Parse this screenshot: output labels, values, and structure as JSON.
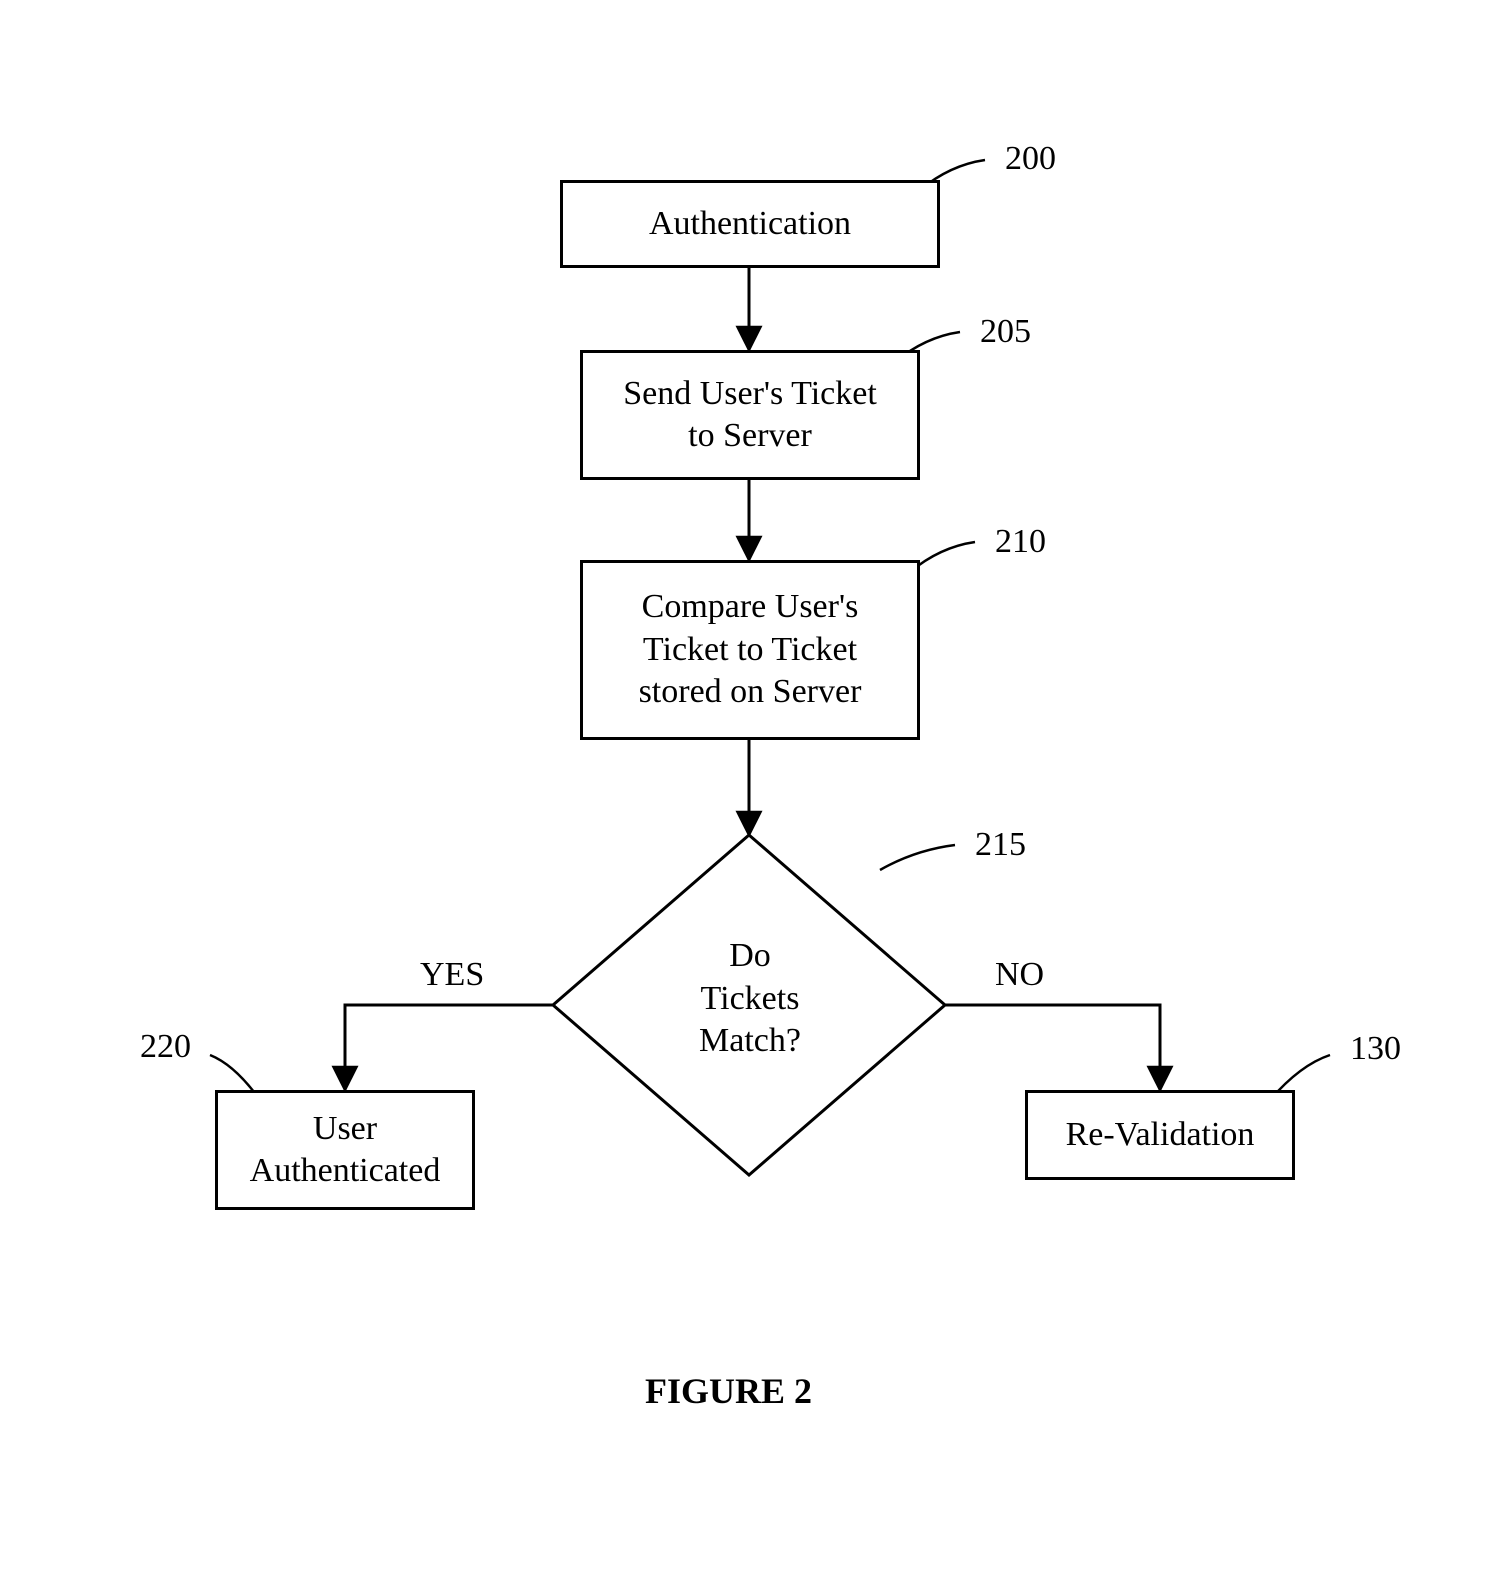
{
  "nodes": {
    "b200": {
      "text": "Authentication",
      "ref": "200"
    },
    "b205": {
      "text": "Send User's Ticket\nto Server",
      "ref": "205"
    },
    "b210": {
      "text": "Compare User's\nTicket to Ticket\nstored on Server",
      "ref": "210"
    },
    "d215": {
      "text": "Do\nTickets\nMatch?",
      "ref": "215"
    },
    "b220": {
      "text": "User\nAuthenticated",
      "ref": "220"
    },
    "b130": {
      "text": "Re-Validation",
      "ref": "130"
    }
  },
  "edges": {
    "yes": "YES",
    "no": "NO"
  },
  "caption": "FIGURE 2"
}
